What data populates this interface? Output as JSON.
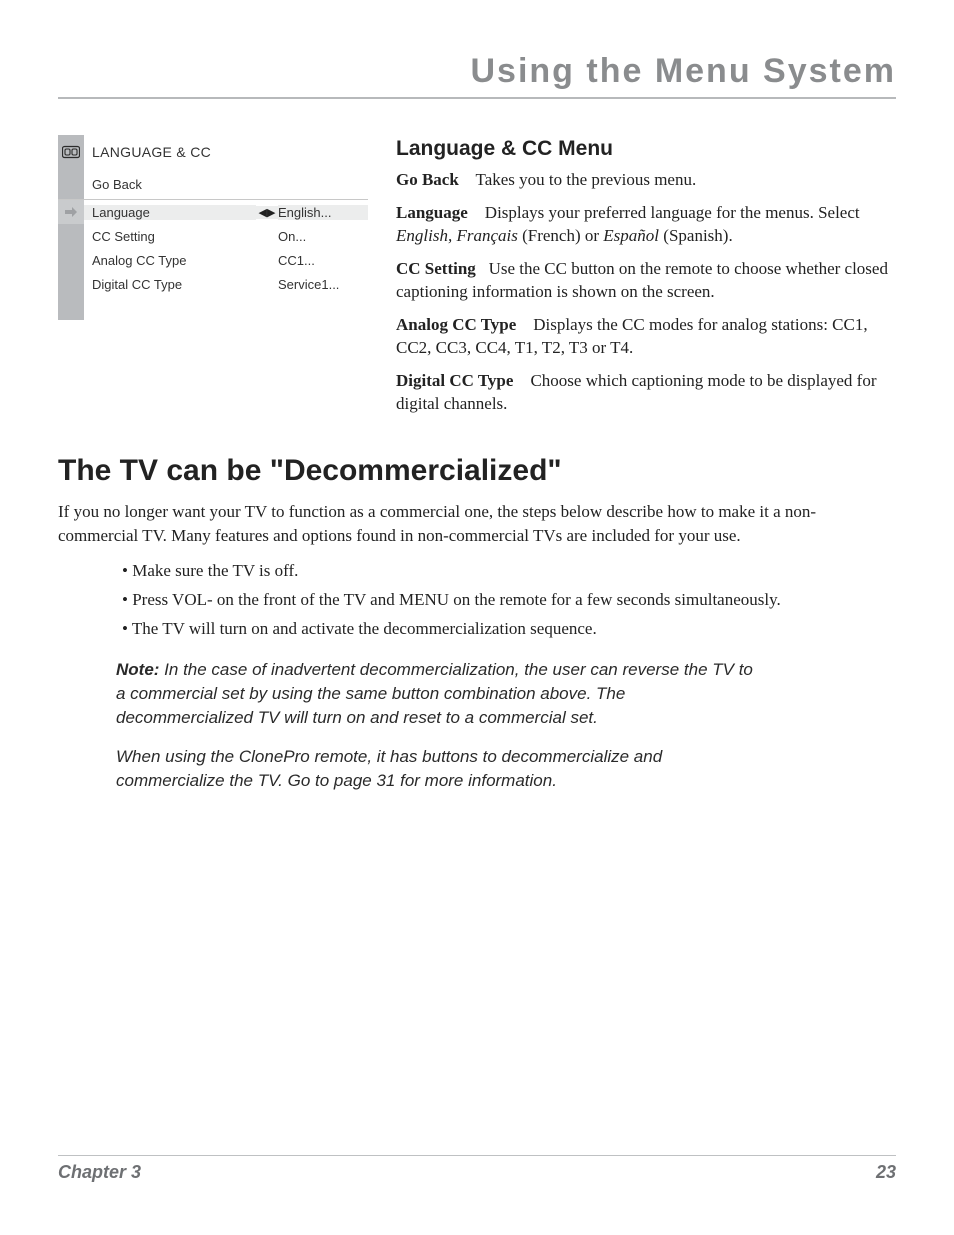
{
  "header": {
    "title": "Using the Menu System"
  },
  "osd": {
    "title": "LANGUAGE & CC",
    "go_back": "Go Back",
    "items": [
      {
        "label": "Language",
        "value": "English...",
        "has_arrows": true,
        "selected": true
      },
      {
        "label": "CC Setting",
        "value": "On...",
        "has_arrows": false,
        "selected": false
      },
      {
        "label": "Analog CC Type",
        "value": "CC1...",
        "has_arrows": false,
        "selected": false
      },
      {
        "label": "Digital CC Type",
        "value": "Service1...",
        "has_arrows": false,
        "selected": false
      }
    ]
  },
  "desc": {
    "heading": "Language & CC Menu",
    "go_back": {
      "term": "Go Back",
      "pre": "",
      "body": "Takes you to the previous menu."
    },
    "language": {
      "term": "Language",
      "body1": "Displays your preferred language for the menus. Select ",
      "i1": "English, Français",
      "body2": " (French) or ",
      "i2": "Español",
      "body3": " (Spanish)."
    },
    "cc_setting": {
      "term": "CC Setting",
      "body": "Use the CC button on the remote to choose whether closed captioning information is shown on the screen."
    },
    "analog": {
      "term": "Analog CC Type",
      "body": "Displays the CC modes for analog stations: CC1, CC2, CC3, CC4, T1, T2, T3 or T4."
    },
    "digital": {
      "term": "Digital CC Type",
      "body": "Choose which captioning mode to be displayed for digital channels."
    }
  },
  "section": {
    "heading": "The TV can be \"Decommercialized\"",
    "intro": "If you no longer want your TV to function as a commercial one, the steps below describe how to make it a non-commercial TV. Many features and options found in non-commercial TVs are included for your use.",
    "bullets": [
      "Make sure the TV is off.",
      "Press VOL- on the front of the TV and MENU on the remote for a few seconds simultaneously.",
      "The TV will turn on and activate the decommercialization sequence."
    ],
    "note_label": "Note:",
    "note1": " In the case of inadvertent decommercialization, the user can reverse the TV to a commercial set by using the same button combination above. The decommercialized TV will turn on and reset to a commercial set.",
    "note2": "When using the ClonePro remote, it has buttons to decommercialize and commercialize the TV. Go to page 31 for more information."
  },
  "footer": {
    "chapter": "Chapter 3",
    "page": "23"
  }
}
